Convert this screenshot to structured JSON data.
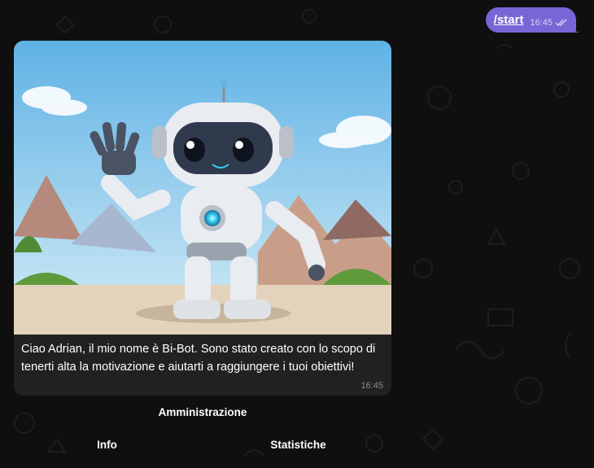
{
  "chat": {
    "outgoing": {
      "text": "/start",
      "time": "16:45",
      "status_icon": "double-check-icon"
    },
    "incoming": {
      "image_alt": "Friendly robot waving in front of mountains",
      "caption": "Ciao Adrian, il mio nome è Bi-Bot. Sono stato creato con lo scopo di tenerti alta la motivazione e aiutarti a raggiungere i tuoi obiettivi!",
      "time": "16:45"
    }
  },
  "keyboard": {
    "rows": [
      [
        {
          "label": "Amministrazione"
        }
      ],
      [
        {
          "label": "Info"
        },
        {
          "label": "Statistiche"
        }
      ]
    ]
  },
  "colors": {
    "background": "#0f0f0f",
    "outgoing_bubble": "#7766d5",
    "incoming_bubble": "#212121",
    "robot_eye_glow": "#35d0f5"
  }
}
